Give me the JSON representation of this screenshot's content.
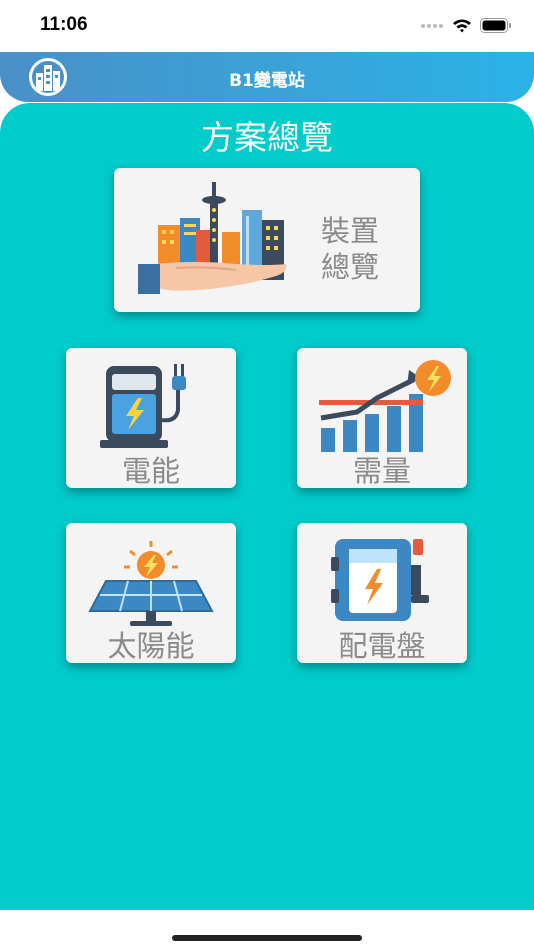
{
  "status_bar": {
    "time": "11:06"
  },
  "header": {
    "title": "B1變電站"
  },
  "page": {
    "title": "方案總覽"
  },
  "cards": {
    "device_overview": {
      "line1": "裝置",
      "line2": "總覽",
      "icon": "city-hand-icon"
    },
    "energy": {
      "label": "電能",
      "icon": "ev-charger-icon"
    },
    "demand": {
      "label": "需量",
      "icon": "demand-chart-icon"
    },
    "solar": {
      "label": "太陽能",
      "icon": "solar-panel-icon"
    },
    "panel": {
      "label": "配電盤",
      "icon": "distribution-panel-icon"
    }
  },
  "colors": {
    "teal": "#00cccc",
    "header_start": "#4a90c8",
    "header_end": "#2ab3e6",
    "label_gray": "#8a8a8a"
  }
}
